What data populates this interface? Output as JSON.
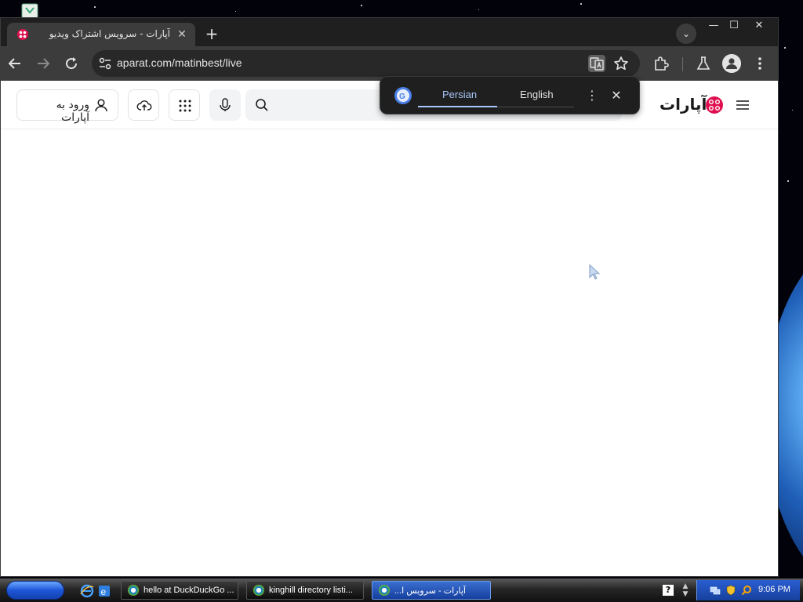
{
  "browser": {
    "tab": {
      "title": "آپارات - سرویس اشتراک ویدیو"
    },
    "address_bar": {
      "url": "aparat.com/matinbest/live"
    }
  },
  "site": {
    "login_label": "ورود به آپارات",
    "logo_text": "آپارات",
    "search_placeholder": ""
  },
  "translate_popup": {
    "source_language": "Persian",
    "target_language": "English",
    "active_language": "Persian"
  },
  "taskbar": {
    "windows": [
      {
        "label": "hello at DuckDuckGo ..."
      },
      {
        "label": "kinghill directory listi..."
      },
      {
        "label": "آپارات - سرویس ا...",
        "active": true
      }
    ],
    "clock": "9:06 PM"
  },
  "colors": {
    "brand": "#df0f50",
    "popup_accent": "#a8c7fa",
    "chrome_dark": "#3c3c3c"
  },
  "icons": [
    "back-icon",
    "forward-icon",
    "reload-icon",
    "site-settings-icon",
    "translate-icon",
    "bookmark-star-icon",
    "extensions-icon",
    "labs-icon",
    "profile-icon",
    "menu-icon",
    "user-icon",
    "upload-icon",
    "apps-grid-icon",
    "microphone-icon",
    "search-icon",
    "aparat-logo-icon",
    "hamburger-icon",
    "google-translate-icon"
  ]
}
